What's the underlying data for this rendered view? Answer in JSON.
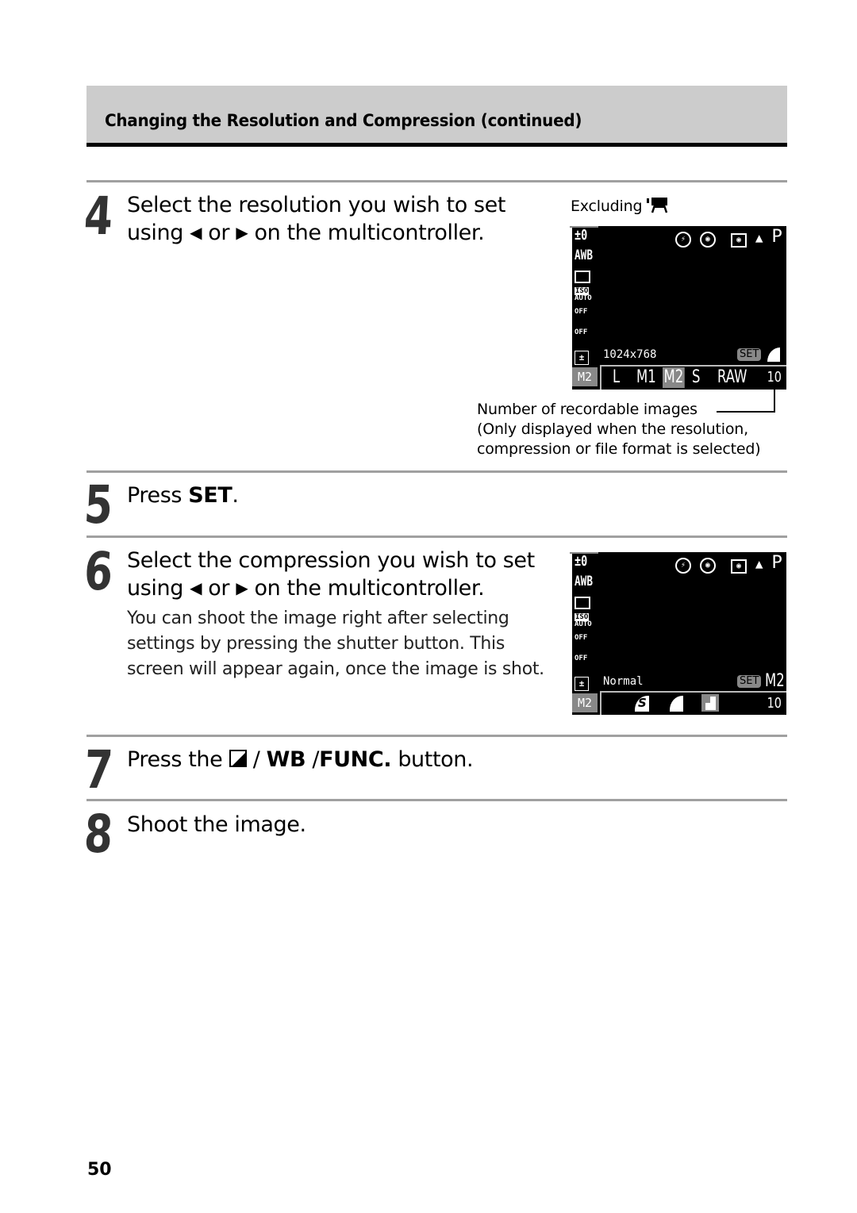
{
  "header": {
    "title": "Changing the Resolution and Compression (continued)"
  },
  "steps": [
    {
      "number": "4",
      "line1": "Select the resolution you wish to set",
      "line2_pre": "using",
      "left_arrow": "◀",
      "or": "or",
      "right_arrow": "▶",
      "line2_post": "on the multicontroller."
    },
    {
      "number": "5",
      "pre": "Press",
      "key": "SET",
      "post": "."
    },
    {
      "number": "6",
      "line1": "Select the compression you wish to set",
      "line2_pre": "using",
      "left_arrow": "◀",
      "or": "or",
      "right_arrow": "▶",
      "line2_post": "on the multicontroller.",
      "note": [
        "You can shoot the image right after selecting",
        "settings by pressing the shutter button.  This",
        "screen will appear again, once the image is shot."
      ]
    },
    {
      "number": "7",
      "pre": "Press the",
      "sep1": "/",
      "wb": "WB",
      "sep2": "/",
      "func": "FUNC.",
      "post": "button."
    },
    {
      "number": "8",
      "text": "Shoot the image."
    }
  ],
  "figure1": {
    "caption_pre": "Excluding",
    "caption_icon": "movie-camera-icon",
    "screen": {
      "ev": "±0",
      "awb": "AWB",
      "iso_top": "ISO",
      "iso_bottom": "AUTO",
      "off1": "OFF",
      "off2": "OFF",
      "flash_comp": "±",
      "mode_btn": "M2",
      "top_right_letter": "P",
      "label": "1024x768",
      "set_badge": "SET",
      "options": [
        "L",
        "M1",
        "M2",
        "S",
        "RAW"
      ],
      "selected_option": "M2",
      "count": "10"
    },
    "annotation": [
      "Number of recordable images",
      "(Only displayed when the resolution,",
      "compression or file format is selected)"
    ]
  },
  "figure2": {
    "screen": {
      "ev": "±0",
      "awb": "AWB",
      "iso_top": "ISO",
      "iso_bottom": "AUTO",
      "off1": "OFF",
      "off2": "OFF",
      "flash_comp": "±",
      "mode_btn": "M2",
      "top_right_letter": "P",
      "label": "Normal",
      "set_badge": "SET",
      "set_value": "M2",
      "options": [
        "superfine-icon",
        "fine-icon",
        "normal-icon"
      ],
      "selected_option": "normal-icon",
      "superfine_glyph": "S",
      "count": "10"
    }
  },
  "page_number": "50"
}
